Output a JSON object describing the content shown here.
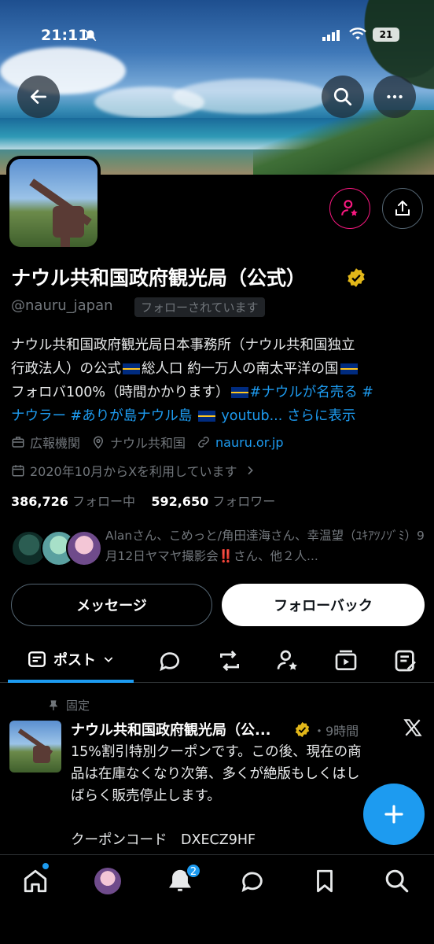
{
  "status_bar": {
    "time": "21:11",
    "battery": "21"
  },
  "profile": {
    "display_name": "ナウル共和国政府観光局（公式）",
    "handle": "@nauru_japan",
    "follows_you": "フォローされています",
    "bio": {
      "line1": "ナウル共和国政府観光局日本事務所（ナウル共和国独立",
      "line2a": "行政法人）の公式",
      "line2b": "総人口 約一万人の南太平洋の国",
      "line3a": "フォロバ100%（時間かかります）",
      "line3b": "#ナウルが名売る #",
      "line4a": "ナウラー #ありが島ナウル島",
      "line4b": "youtub...",
      "more": "さらに表示"
    },
    "category": "広報機関",
    "location": "ナウル共和国",
    "website": "nauru.or.jp",
    "joined": "2020年10月からXを利用しています",
    "following_count": "386,726",
    "following_label": "フォロー中",
    "followers_count": "592,650",
    "followers_label": "フォロワー",
    "followed_by": "Alanさん、こめっと/角田達海さん、幸温望（ﾕｷｱﾂﾉｿﾞﾐ）9月12日ヤマヤ撮影会‼️さん、他２人..."
  },
  "buttons": {
    "message": "メッセージ",
    "follow_back": "フォローバック"
  },
  "tabs": {
    "posts": "ポスト"
  },
  "pinned_post": {
    "pinned_label": "固定",
    "author": "ナウル共和国政府観光局（公...",
    "time": "・9時間",
    "text_line1": "15%割引特別クーポンです。この後、現在の商",
    "text_line2": "品は在庫なくなり次第、多くが絶版もしくはし",
    "text_line3": "ばらく販売停止します。",
    "text_line5": "クーポンコード　DXECZ9HF"
  },
  "bottom_nav": {
    "notifications_badge": "2"
  },
  "colors": {
    "accent": "#1d9bf0",
    "pink": "#f91880",
    "verified_gold": "#e2b719"
  },
  "icons": [
    "back-icon",
    "search-icon",
    "more-icon",
    "follow-star-icon",
    "share-icon",
    "briefcase-icon",
    "location-icon",
    "link-icon",
    "calendar-icon",
    "reply-icon",
    "repost-icon",
    "media-icon",
    "articles-icon",
    "home-icon",
    "bell-icon",
    "chat-icon",
    "bookmark-icon",
    "plus-icon",
    "x-logo-icon"
  ]
}
